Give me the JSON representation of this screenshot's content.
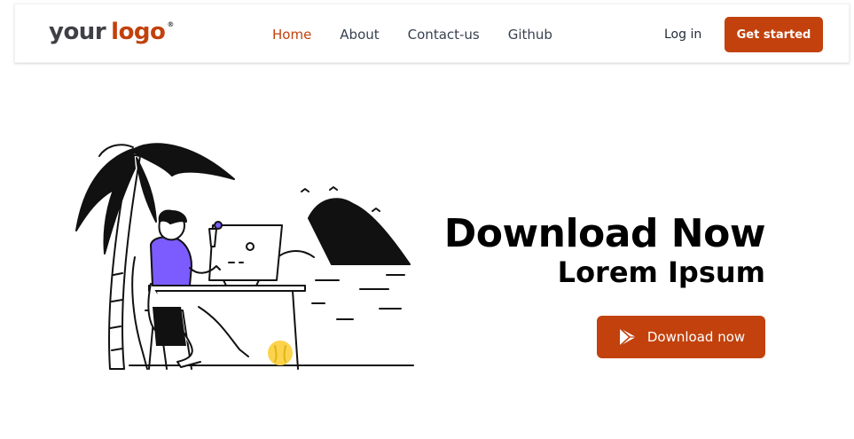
{
  "brand": {
    "logo_part1": "your",
    "logo_part2": "logo",
    "logo_mark": "®"
  },
  "nav": {
    "items": [
      {
        "label": "Home",
        "active": true
      },
      {
        "label": "About",
        "active": false
      },
      {
        "label": "Contact-us",
        "active": false
      },
      {
        "label": "Github",
        "active": false
      }
    ],
    "login_label": "Log in",
    "cta_label": "Get started"
  },
  "hero": {
    "title": "Download Now",
    "subtitle": "Lorem Ipsum",
    "button_label": "Download now",
    "button_icon": "play-store-icon",
    "illustration": "person-working-on-laptop-at-beach-illustration"
  },
  "colors": {
    "accent": "#c2410c",
    "text": "#1f2937",
    "illustration_shirt": "#7c5cff",
    "illustration_ball": "#fcd34d"
  }
}
